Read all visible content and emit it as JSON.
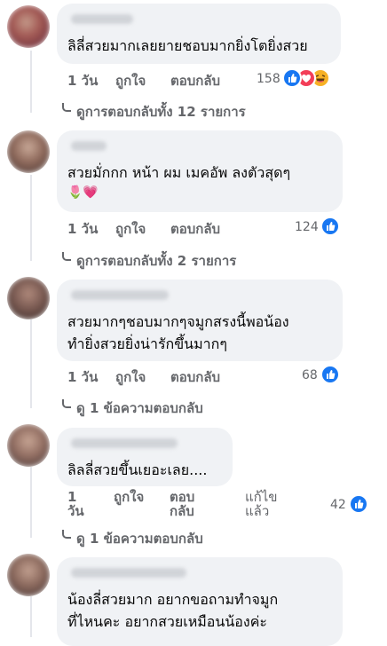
{
  "comments": [
    {
      "text_lines": [
        "ลิลี่สวยมากเลยยายชอบมากยิ่งโตยิ่งสวย"
      ],
      "time": "1 วัน",
      "like": "ถูกใจ",
      "reply": "ตอบกลับ",
      "reaction_count": "158",
      "reaction_icons": [
        "like-icon",
        "love-icon",
        "haha-icon"
      ],
      "view_replies": "ดูการตอบกลับทั้ง 12 รายการ"
    },
    {
      "text_lines": [
        "สวยมั่กกก หน้า ผม เมคอัพ ลงตัวสุดๆ",
        "🌷💗"
      ],
      "time": "1 วัน",
      "like": "ถูกใจ",
      "reply": "ตอบกลับ",
      "reaction_count": "124",
      "reaction_icons": [
        "like-icon"
      ],
      "view_replies": "ดูการตอบกลับทั้ง 2 รายการ"
    },
    {
      "text_lines": [
        "สวยมากๆชอบมากๆจมูกสรงนี้พอน้อง",
        "ทำยิ่งสวยยิ่งน่ารักขึ้นมากๆ"
      ],
      "time": "1 วัน",
      "like": "ถูกใจ",
      "reply": "ตอบกลับ",
      "reaction_count": "68",
      "reaction_icons": [
        "like-icon"
      ],
      "view_replies": "ดู 1 ข้อความตอบกลับ"
    },
    {
      "text_lines": [
        "ลิลลี่สวยขึ้นเยอะเลย...."
      ],
      "time_lines": [
        "1",
        "วัน"
      ],
      "like": "ถูกใจ",
      "reply_lines": [
        "ตอบ",
        "กลับ"
      ],
      "edit_lines": [
        "แก้ไข",
        "แล้ว"
      ],
      "reaction_count": "42",
      "reaction_icons": [
        "like-icon"
      ],
      "view_replies": "ดู 1 ข้อความตอบกลับ"
    },
    {
      "text_lines": [
        "น้องลี่สวยมาก อยากขอถามทำจมูก",
        "ที่ไหนคะ อยากสวยเหมือนน้องค่ะ"
      ]
    }
  ],
  "colors": {
    "bubble": "#f0f2f5",
    "secondary_text": "#65676b",
    "like_blue": "#1877f2",
    "love_red": "#f33e58",
    "haha_yellow": "#f7b125"
  }
}
